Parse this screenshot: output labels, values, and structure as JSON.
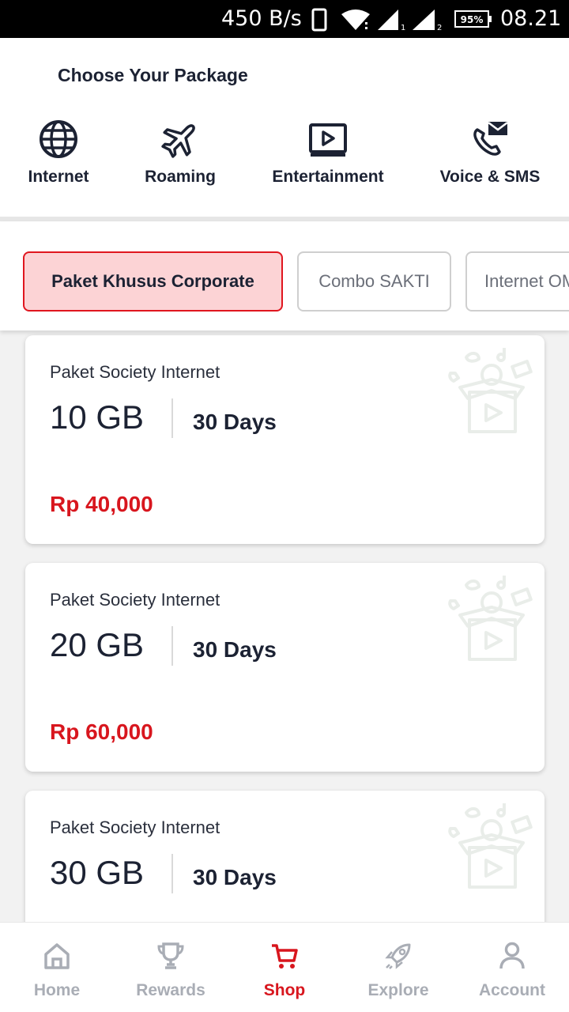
{
  "status_bar": {
    "net_speed": "450 B/s",
    "battery": "95%",
    "time": "08.21",
    "sim1": "1",
    "sim2": "2"
  },
  "header": {
    "title": "Choose Your Package",
    "tabs": [
      {
        "label": "Internet",
        "icon": "globe-icon",
        "selected": true
      },
      {
        "label": "Roaming",
        "icon": "airplane-icon",
        "selected": false
      },
      {
        "label": "Entertainment",
        "icon": "play-icon",
        "selected": false
      },
      {
        "label": "Voice & SMS",
        "icon": "phone-message-icon",
        "selected": false
      }
    ]
  },
  "filters": [
    {
      "label": "Paket Khusus Corporate",
      "selected": true
    },
    {
      "label": "Combo SAKTI",
      "selected": false
    },
    {
      "label": "Internet OMG!",
      "selected": false
    }
  ],
  "packages": [
    {
      "name": "Paket Society Internet",
      "quota": "10 GB",
      "duration": "30 Days",
      "price": "Rp 40,000"
    },
    {
      "name": "Paket Society Internet",
      "quota": "20 GB",
      "duration": "30 Days",
      "price": "Rp 60,000"
    },
    {
      "name": "Paket Society Internet",
      "quota": "30 GB",
      "duration": "30 Days",
      "price": ""
    }
  ],
  "bottom_nav": [
    {
      "label": "Home",
      "icon": "home-icon",
      "active": false
    },
    {
      "label": "Rewards",
      "icon": "trophy-icon",
      "active": false
    },
    {
      "label": "Shop",
      "icon": "cart-icon",
      "active": true
    },
    {
      "label": "Explore",
      "icon": "rocket-icon",
      "active": false
    },
    {
      "label": "Account",
      "icon": "user-icon",
      "active": false
    }
  ],
  "colors": {
    "accent": "#e0161f",
    "price": "#d8161e",
    "chip_active_bg": "#fcd3d5",
    "text_dark": "#1c2233",
    "nav_inactive": "#a9adb5"
  }
}
